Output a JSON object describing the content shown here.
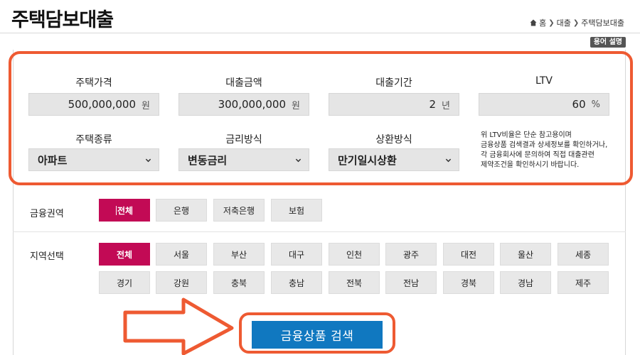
{
  "page": {
    "title": "주택담보대출"
  },
  "breadcrumb": {
    "home": "홈",
    "section": "대출",
    "current": "주택담보대출"
  },
  "glossary_button": "용어 설명",
  "fields": {
    "house_price": {
      "label": "주택가격",
      "value": "500,000,000",
      "unit": "원"
    },
    "loan_amount": {
      "label": "대출금액",
      "value": "300,000,000",
      "unit": "원"
    },
    "loan_period": {
      "label": "대출기간",
      "value": "2",
      "unit": "년"
    },
    "ltv": {
      "label": "LTV",
      "value": "60",
      "unit": "%"
    }
  },
  "selects": {
    "house_type": {
      "label": "주택종류",
      "value": "아파트"
    },
    "rate_type": {
      "label": "금리방식",
      "value": "변동금리"
    },
    "repayment": {
      "label": "상환방식",
      "value": "만기일시상환"
    }
  },
  "ltv_note": {
    "line1": "위 LTV비율은 단순 참고용이며",
    "line2": "금융상품 검색결과 상세정보를 확인하거나,",
    "line3": "각 금융회사에 문의하여 직접 대출관련",
    "line4": "제약조건을 확인하시기 바랍니다."
  },
  "financial_sector": {
    "label": "금융권역",
    "options": [
      "전체",
      "은행",
      "저축은행",
      "보험"
    ],
    "selected": "전체"
  },
  "region": {
    "label": "지역선택",
    "row1": [
      "전체",
      "서울",
      "부산",
      "대구",
      "인천",
      "광주",
      "대전",
      "울산",
      "세종"
    ],
    "row2": [
      "경기",
      "강원",
      "충북",
      "충남",
      "전북",
      "전남",
      "경북",
      "경남",
      "제주"
    ],
    "selected": "전체"
  },
  "search_button": "금융상품 검색",
  "colors": {
    "accent_chip": "#c20a55",
    "search_button": "#1078c0",
    "highlight_outline": "#ee5a32",
    "field_background": "#e5e5e5"
  },
  "icons": {
    "breadcrumb_home": "home-icon",
    "select_dropdown": "chevron-down-icon",
    "annotation_arrow": "arrow-right-icon"
  }
}
